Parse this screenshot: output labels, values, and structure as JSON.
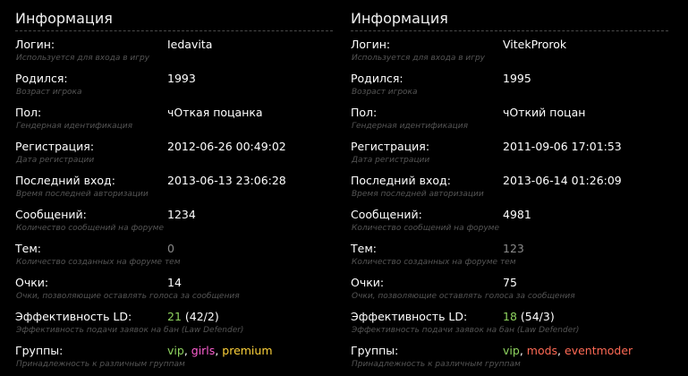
{
  "left": {
    "title": "Информация",
    "rows": [
      {
        "label": "Логин:",
        "hint": "Используется для входа в игру",
        "value": "Iedavita"
      },
      {
        "label": "Родился:",
        "hint": "Возраст игрока",
        "value": "1993"
      },
      {
        "label": "Пол:",
        "hint": "Гендерная идентификация",
        "value": "чОткая поцанка"
      },
      {
        "label": "Регистрация:",
        "hint": "Дата регистрации",
        "value": "2012-06-26 00:49:02"
      },
      {
        "label": "Последний вход:",
        "hint": "Время последней авторизации",
        "value": "2013-06-13 23:06:28"
      },
      {
        "label": "Сообщений:",
        "hint": "Количество сообщений на форуме",
        "value": "1234"
      },
      {
        "label": "Тем:",
        "hint": "Количество созданных на форуме тем",
        "value": "0"
      },
      {
        "label": "Очки:",
        "hint": "Очки, позволяющие оставлять голоса за сообщения",
        "value": "14"
      },
      {
        "label": "Эффективность LD:",
        "hint": "Эффективность подачи заявок на бан (Law Defender)",
        "value_main": "21",
        "value_extra": " (42/2)"
      },
      {
        "label": "Группы:",
        "hint": "Принадлежность к различным группам",
        "groups": [
          "vip",
          ", ",
          "girls",
          ", ",
          "premium"
        ]
      }
    ]
  },
  "right": {
    "title": "Информация",
    "rows": [
      {
        "label": "Логин:",
        "hint": "Используется для входа в игру",
        "value": "VitekProrok"
      },
      {
        "label": "Родился:",
        "hint": "Возраст игрока",
        "value": "1995"
      },
      {
        "label": "Пол:",
        "hint": "Гендерная идентификация",
        "value": "чОткий поцан"
      },
      {
        "label": "Регистрация:",
        "hint": "Дата регистрации",
        "value": "2011-09-06 17:01:53"
      },
      {
        "label": "Последний вход:",
        "hint": "Время последней авторизации",
        "value": "2013-06-14 01:26:09"
      },
      {
        "label": "Сообщений:",
        "hint": "Количество сообщений на форуме",
        "value": "4981"
      },
      {
        "label": "Тем:",
        "hint": "Количество созданных на форуме тем",
        "value": "123"
      },
      {
        "label": "Очки:",
        "hint": "Очки, позволяющие оставлять голоса за сообщения",
        "value": "75"
      },
      {
        "label": "Эффективность LD:",
        "hint": "Эффективность подачи заявок на бан (Law Defender)",
        "value_main": "18",
        "value_extra": " (54/3)"
      },
      {
        "label": "Группы:",
        "hint": "Принадлежность к различным группам",
        "groups": [
          "vip",
          ", ",
          "mods",
          ", ",
          "eventmoder"
        ]
      }
    ]
  },
  "colors": {
    "ld_value": "#8ed35f",
    "group_vip": "#8ed35f",
    "group_girls": "#ff5fd2",
    "group_premium": "#ffd23a",
    "group_mods": "#ff6a55",
    "group_eventmoder": "#ff6a55"
  }
}
